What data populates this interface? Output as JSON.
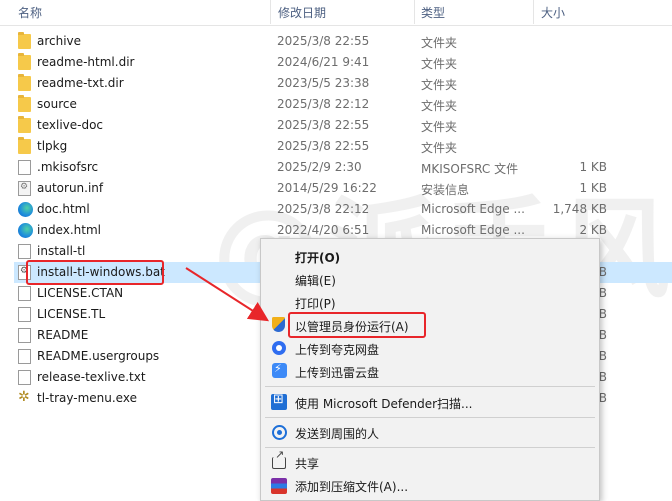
{
  "header": {
    "name": "名称",
    "date": "修改日期",
    "type": "类型",
    "size": "大小"
  },
  "files": [
    {
      "name": "archive",
      "date": "2025/3/8 22:55",
      "type": "文件夹",
      "size": "",
      "icon": "folder-icon"
    },
    {
      "name": "readme-html.dir",
      "date": "2024/6/21 9:41",
      "type": "文件夹",
      "size": "",
      "icon": "folder-icon"
    },
    {
      "name": "readme-txt.dir",
      "date": "2023/5/5 23:38",
      "type": "文件夹",
      "size": "",
      "icon": "folder-icon"
    },
    {
      "name": "source",
      "date": "2025/3/8 22:12",
      "type": "文件夹",
      "size": "",
      "icon": "folder-icon"
    },
    {
      "name": "texlive-doc",
      "date": "2025/3/8 22:55",
      "type": "文件夹",
      "size": "",
      "icon": "folder-icon"
    },
    {
      "name": "tlpkg",
      "date": "2025/3/8 22:55",
      "type": "文件夹",
      "size": "",
      "icon": "folder-icon"
    },
    {
      "name": ".mkisofsrc",
      "date": "2025/2/9 2:30",
      "type": "MKISOFSRC 文件",
      "size": "1 KB",
      "icon": "file-icon"
    },
    {
      "name": "autorun.inf",
      "date": "2014/5/29 16:22",
      "type": "安装信息",
      "size": "1 KB",
      "icon": "setup-info-icon"
    },
    {
      "name": "doc.html",
      "date": "2025/3/8 22:12",
      "type": "Microsoft Edge ...",
      "size": "1,748 KB",
      "icon": "edge-icon"
    },
    {
      "name": "index.html",
      "date": "2022/4/20 6:51",
      "type": "Microsoft Edge ...",
      "size": "2 KB",
      "icon": "edge-icon"
    },
    {
      "name": "install-tl",
      "date": "",
      "type": "",
      "size": "",
      "icon": "file-icon"
    },
    {
      "name": "install-tl-windows.bat",
      "date": "",
      "type": "",
      "size": "B",
      "icon": "batch-file-icon"
    },
    {
      "name": "LICENSE.CTAN",
      "date": "",
      "type": "",
      "size": "B",
      "icon": "file-icon"
    },
    {
      "name": "LICENSE.TL",
      "date": "",
      "type": "",
      "size": "B",
      "icon": "file-icon"
    },
    {
      "name": "README",
      "date": "",
      "type": "",
      "size": "B",
      "icon": "file-icon"
    },
    {
      "name": "README.usergroups",
      "date": "",
      "type": "",
      "size": "B",
      "icon": "file-icon"
    },
    {
      "name": "release-texlive.txt",
      "date": "",
      "type": "",
      "size": "B",
      "icon": "file-icon"
    },
    {
      "name": "tl-tray-menu.exe",
      "date": "",
      "type": "",
      "size": "B",
      "icon": "exe-icon"
    }
  ],
  "context_menu": {
    "open": "打开(O)",
    "edit": "编辑(E)",
    "print": "打印(P)",
    "run_as_admin": "以管理员身份运行(A)",
    "upload_quark": "上传到夸克网盘",
    "upload_xunlei": "上传到迅雷云盘",
    "defender": "使用 Microsoft Defender扫描...",
    "send_nearby": "发送到周围的人",
    "share": "共享",
    "add_archive": "添加到压缩文件(A)..."
  },
  "watermark": "@派手风",
  "colors": {
    "selection": "#cce8ff",
    "highlight_red": "#e8262a",
    "menu_bg": "#f2f2f2"
  }
}
